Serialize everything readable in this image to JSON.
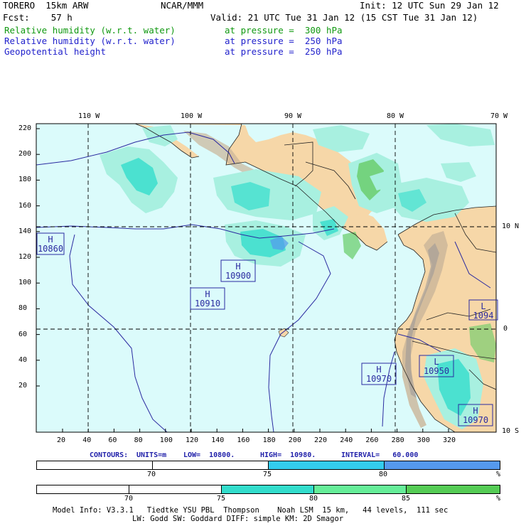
{
  "header": {
    "model": "TORERO  15km ARW",
    "org": "NCAR/MMM",
    "init": "Init: 12 UTC Sun 29 Jan 12",
    "fcst": "Fcst:    57 h",
    "valid": "Valid: 21 UTC Tue 31 Jan 12 (15 CST Tue 31 Jan 12)"
  },
  "fields": [
    {
      "name": "Relative humidity (w.r.t. water)",
      "level": "at pressure =  300 hPa",
      "color": "#119911"
    },
    {
      "name": "Relative humidity (w.r.t. water)",
      "level": "at pressure =  250 hPa",
      "color": "#2222cc"
    },
    {
      "name": "Geopotential height",
      "level": "at pressure =  250 hPa",
      "color": "#2222cc"
    }
  ],
  "map": {
    "lon_labels": [
      "110 W",
      "100 W",
      "90 W",
      "80 W",
      "70 W"
    ],
    "lat_labels": [
      "10 N",
      "0",
      "10 S"
    ],
    "grid_y_ticks": [
      "220",
      "200",
      "180",
      "160",
      "140",
      "120",
      "100",
      "80",
      "60",
      "40",
      "20"
    ],
    "grid_x_ticks": [
      "20",
      "40",
      "60",
      "80",
      "100",
      "120",
      "140",
      "160",
      "180",
      "200",
      "220",
      "240",
      "260",
      "280",
      "300",
      "320"
    ],
    "centers": [
      {
        "type": "H",
        "value": "10860"
      },
      {
        "type": "H",
        "value": "10900"
      },
      {
        "type": "H",
        "value": "10910"
      },
      {
        "type": "H",
        "value": "10970"
      },
      {
        "type": "L",
        "value": "10950"
      },
      {
        "type": "L",
        "value": "1094"
      },
      {
        "type": "H",
        "value": "10970"
      }
    ],
    "colors": {
      "ocean": "#dbfbfb",
      "land": "#f6d7a8",
      "rh_low": "#a8f0e0",
      "rh_mid": "#33ddcc",
      "rh_high": "#66cc66",
      "rh_blue": "#5599ee",
      "contour": "#2a2aa0"
    }
  },
  "contours_line": {
    "label": "CONTOURS:",
    "units": "UNITS=m",
    "low": "LOW=  10800.",
    "high": "HIGH=  10980.",
    "interval": "INTERVAL=   60.000"
  },
  "legend1": {
    "labels": [
      "70",
      "75",
      "80",
      "%"
    ],
    "colors": [
      "#ffffff",
      "#ffffff",
      "#33ccee",
      "#5599ee"
    ]
  },
  "legend2": {
    "labels": [
      "70",
      "75",
      "80",
      "85",
      "%"
    ],
    "colors": [
      "#ffffff",
      "#ffffff",
      "#33ddcc",
      "#66ee99",
      "#55cc55"
    ]
  },
  "footer": {
    "line1": "Model Info: V3.3.1   Tiedtke YSU PBL  Thompson    Noah LSM  15 km,   44 levels,  111 sec",
    "line2": "LW: Godd SW: Goddard DIFF: simple KM: 2D Smagor"
  }
}
